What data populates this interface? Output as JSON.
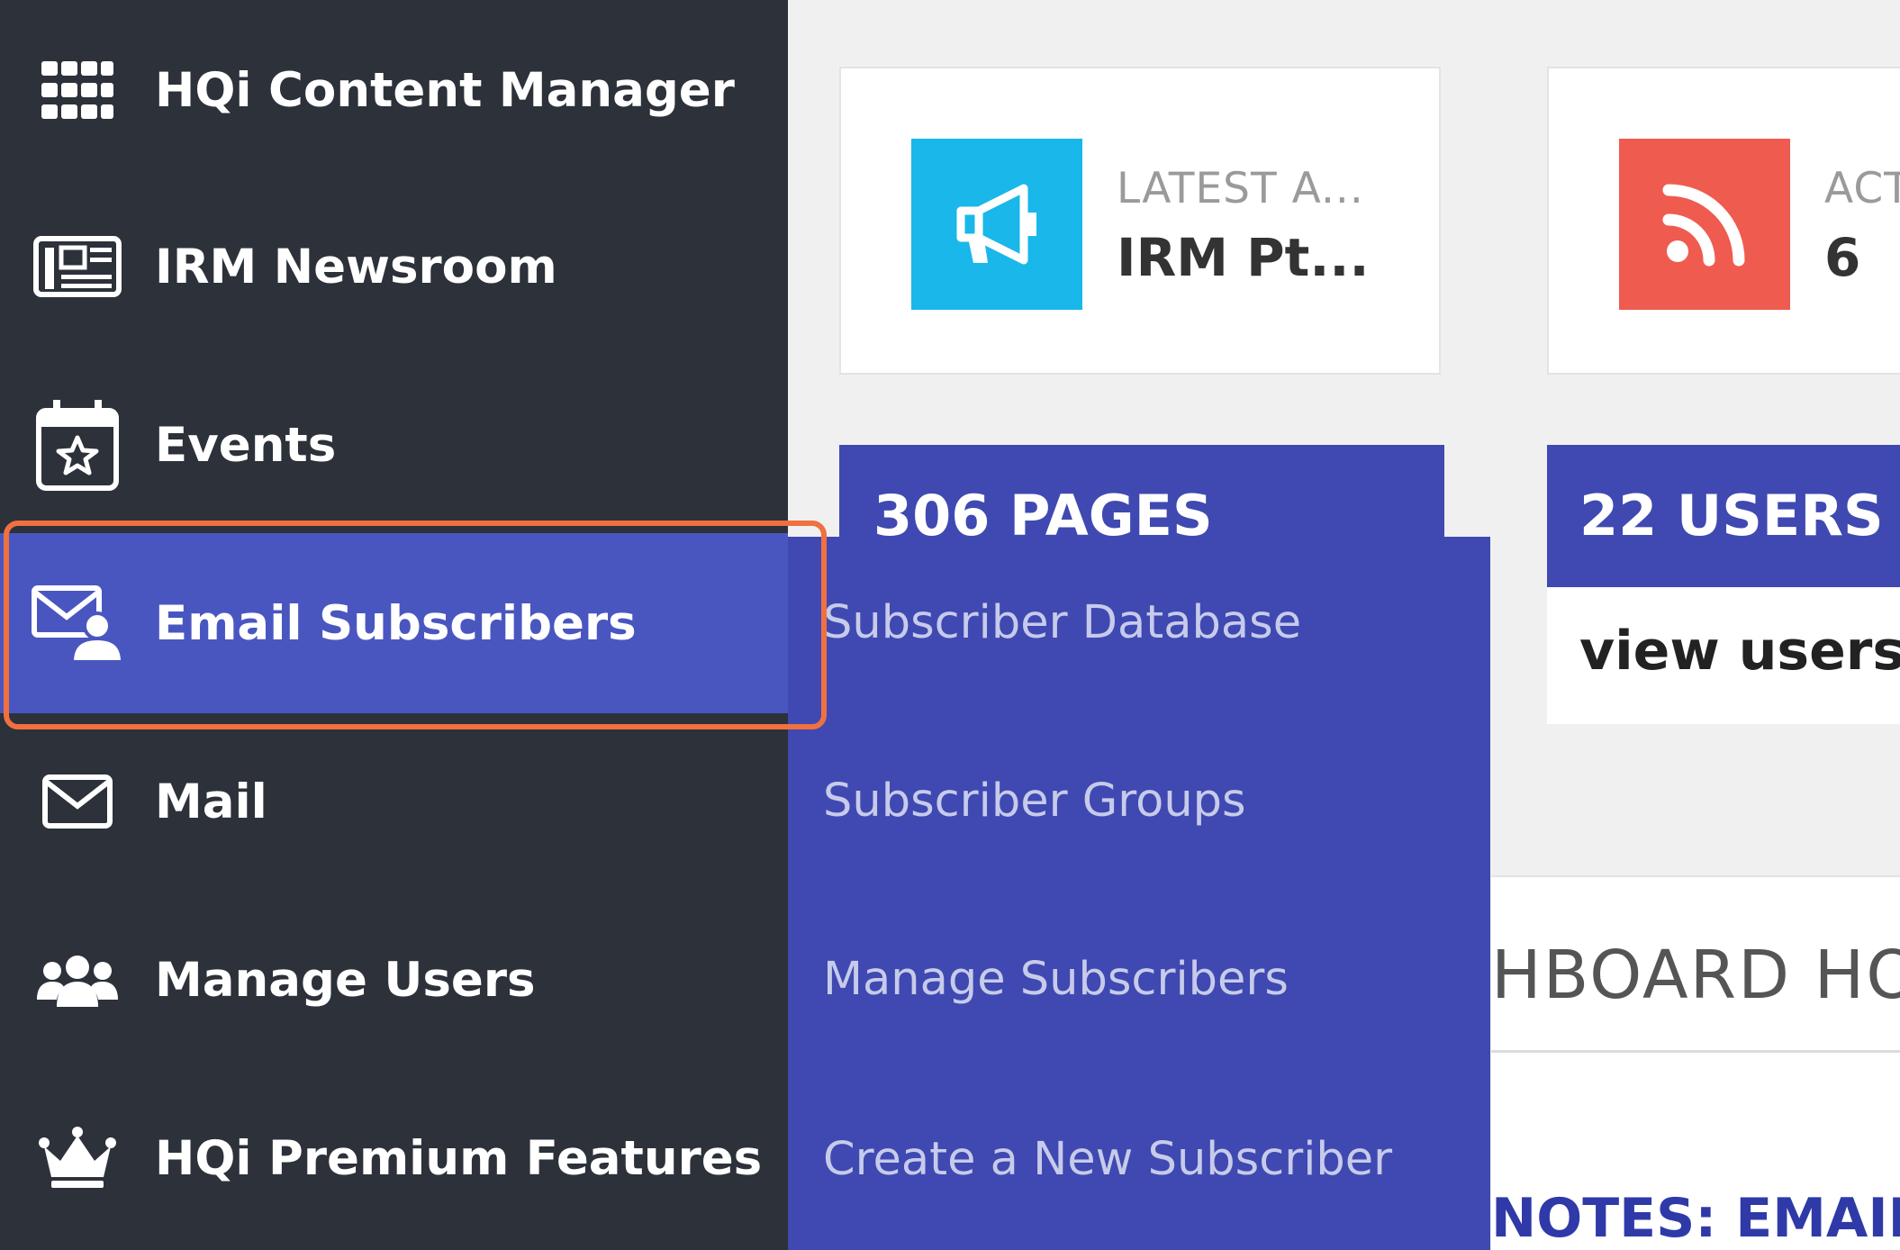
{
  "sidebar": {
    "items": [
      {
        "label": "HQi Content Manager",
        "icon": "grid-icon"
      },
      {
        "label": "IRM Newsroom",
        "icon": "newspaper-icon"
      },
      {
        "label": "Events",
        "icon": "calendar-star-icon"
      },
      {
        "label": "Email Subscribers",
        "icon": "email-subscriber-icon",
        "active": true
      },
      {
        "label": "Mail",
        "icon": "envelope-icon"
      },
      {
        "label": "Manage Users",
        "icon": "users-icon"
      },
      {
        "label": "HQi Premium Features",
        "icon": "crown-icon"
      }
    ]
  },
  "submenu": {
    "items": [
      {
        "label": "Subscriber Database"
      },
      {
        "label": "Subscriber Groups"
      },
      {
        "label": "Manage Subscribers"
      },
      {
        "label": "Create a New Subscriber"
      }
    ]
  },
  "cards": {
    "announcement": {
      "small": "LATEST A...",
      "big": "IRM Pt...",
      "icon": "megaphone-icon",
      "color": "#1ab7ea"
    },
    "activity": {
      "small": "ACT",
      "big": "6",
      "icon": "rss-icon",
      "color": "#ef5b4f"
    }
  },
  "stats": {
    "pages": {
      "label": "306 PAGES"
    },
    "users": {
      "label": "22 USERS",
      "link": "view users"
    }
  },
  "panel": {
    "title": "HBOARD HO",
    "notes": "NOTES: EMAIL T"
  },
  "colors": {
    "sidebar_bg": "#2c313a",
    "active_bg": "#4a56c0",
    "submenu_bg": "#3f49b1",
    "highlight": "#f07040"
  }
}
